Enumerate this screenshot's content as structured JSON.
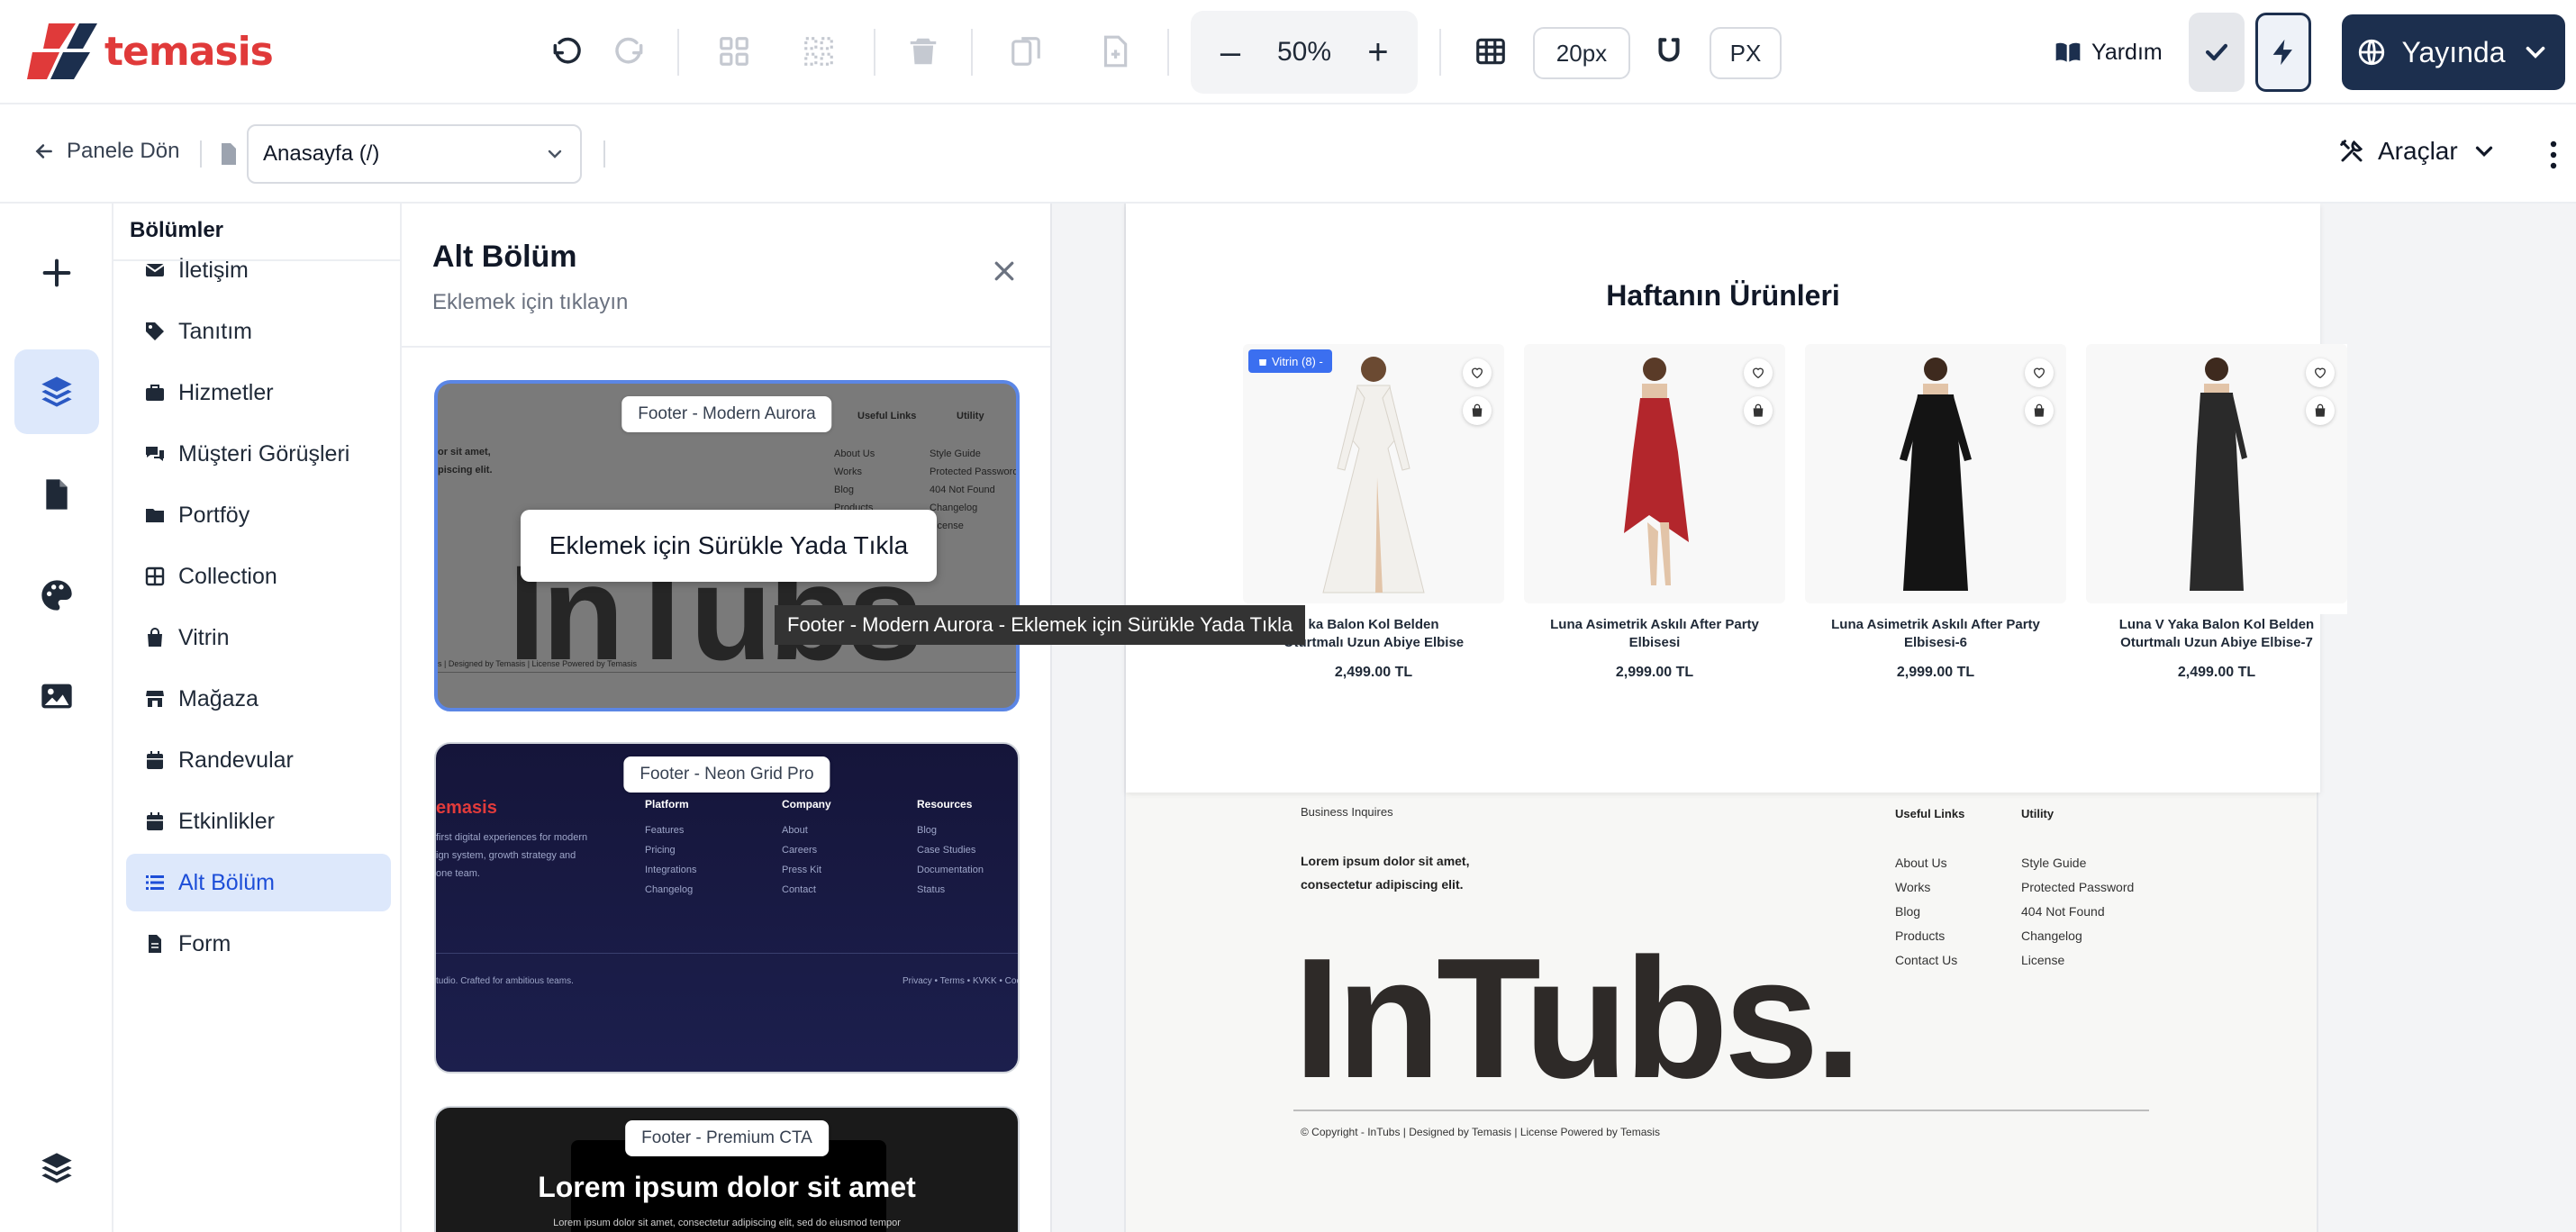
{
  "brand": {
    "name": "temasis",
    "color": "#e03a3a"
  },
  "toolbar": {
    "zoom": {
      "minus": "–",
      "value": "50%",
      "plus": "+"
    },
    "grid_size": "20px",
    "unit": "PX",
    "help": "Yardım",
    "publish": "Yayında",
    "icons": [
      "undo-icon",
      "redo-icon",
      "grid-icon",
      "grid-dashed-icon",
      "trash-icon",
      "duplicate-icon",
      "add-page-icon",
      "table-icon",
      "magnet-icon",
      "book-icon",
      "check-icon",
      "bolt-icon",
      "globe-icon",
      "chevron-down-icon"
    ]
  },
  "subbar": {
    "back": "Panele Dön",
    "page_select": "Anasayfa (/)",
    "tools": "Araçlar"
  },
  "sections": {
    "title": "Bölümler",
    "items": [
      {
        "label": "İletişim",
        "icon": "envelope-icon"
      },
      {
        "label": "Tanıtım",
        "icon": "tag-icon"
      },
      {
        "label": "Hizmetler",
        "icon": "briefcase-icon"
      },
      {
        "label": "Müşteri Görüşleri",
        "icon": "comments-icon"
      },
      {
        "label": "Portföy",
        "icon": "folder-icon"
      },
      {
        "label": "Collection",
        "icon": "table-icon"
      },
      {
        "label": "Vitrin",
        "icon": "bag-icon"
      },
      {
        "label": "Mağaza",
        "icon": "store-icon"
      },
      {
        "label": "Randevular",
        "icon": "calendar-icon"
      },
      {
        "label": "Etkinlikler",
        "icon": "calendar-icon"
      },
      {
        "label": "Alt Bölüm",
        "icon": "list-icon",
        "active": true
      },
      {
        "label": "Form",
        "icon": "document-icon"
      }
    ]
  },
  "panel": {
    "title": "Alt Bölüm",
    "subtitle": "Eklemek için tıklayın",
    "drag_hint": "Eklemek için Sürükle Yada Tıkla",
    "tooltip": "Footer - Modern Aurora - Eklemek için Sürükle Yada Tıkla",
    "cards": [
      {
        "label": "Footer - Modern Aurora",
        "preview": {
          "bigword": "InTubs",
          "lorem1": "or sit amet,",
          "lorem2": "piscing elit.",
          "useful": "Useful Links",
          "utility": "Utility",
          "links": [
            "About Us",
            "Works",
            "Blog",
            "Products"
          ],
          "util_links": [
            "Style Guide",
            "Protected Password",
            "404 Not Found",
            "Changelog",
            "License"
          ],
          "copy": "s | Designed by Temasis | License Powered by Temasis"
        }
      },
      {
        "label": "Footer - Neon Grid Pro",
        "preview": {
          "logo": "emasis",
          "tagline1": "first digital experiences for modern",
          "tagline2": "ign system, growth strategy and",
          "tagline3": "one team.",
          "cols": [
            {
              "head": "Platform",
              "links": [
                "Features",
                "Pricing",
                "Integrations",
                "Changelog"
              ]
            },
            {
              "head": "Company",
              "links": [
                "About",
                "Careers",
                "Press Kit",
                "Contact"
              ]
            },
            {
              "head": "Resources",
              "links": [
                "Blog",
                "Case Studies",
                "Documentation",
                "Status"
              ]
            }
          ],
          "bottom_left": "tudio. Crafted for ambitious teams.",
          "bottom_right": "Privacy • Terms • KVKK • Cook"
        }
      },
      {
        "label": "Footer - Premium CTA",
        "preview": {
          "title": "Lorem ipsum dolor sit amet",
          "sub": "Lorem ipsum dolor sit amet, consectetur adipiscing elit, sed do eiusmod tempor"
        }
      }
    ]
  },
  "canvas": {
    "products_title": "Haftanın Ürünleri",
    "badge": "Vitrin (8) -",
    "products": [
      {
        "name1": "ka Balon Kol Belden",
        "name2": "Oturtmalı Uzun Abiye Elbise",
        "price": "2,499.00 TL",
        "dress_color": "#f2f0ec"
      },
      {
        "name1": "Luna Asimetrik Askılı After Party",
        "name2": "Elbisesi",
        "price": "2,999.00 TL",
        "dress_color": "#b3262c"
      },
      {
        "name1": "Luna Asimetrik Askılı After Party",
        "name2": "Elbisesi-6",
        "price": "2,999.00 TL",
        "dress_color": "#141414"
      },
      {
        "name1": "Luna V Yaka Balon Kol Belden",
        "name2": "Oturtmalı Uzun Abiye Elbise-7",
        "price": "2,499.00 TL",
        "dress_color": "#2a2a2a"
      }
    ],
    "footer": {
      "business": "Business Inquires",
      "lorem1": "Lorem ipsum dolor sit amet,",
      "lorem2": "consectetur adipiscing elit.",
      "useful_head": "Useful Links",
      "utility_head": "Utility",
      "useful_links": [
        "About Us",
        "Works",
        "Blog",
        "Products",
        "Contact Us"
      ],
      "utility_links": [
        "Style Guide",
        "Protected Password",
        "404 Not Found",
        "Changelog",
        "License"
      ],
      "bigword": "InTubs.",
      "copyright": "© Copyright - InTubs | Designed by Temasis | License Powered by Temasis"
    }
  },
  "colors": {
    "accent": "#1d4ed8",
    "active_bg": "#dde8fb",
    "publish_bg": "#1c2f4e",
    "selection": "#5b86e5"
  }
}
